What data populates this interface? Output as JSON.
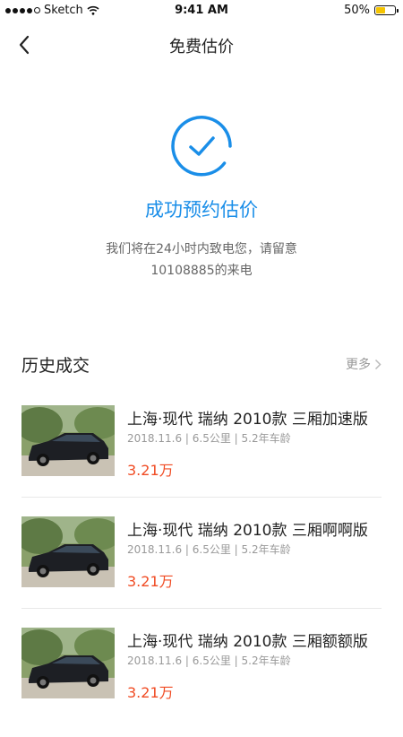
{
  "status_bar": {
    "carrier": "Sketch",
    "time": "9:41 AM",
    "battery": "50%",
    "battery_level": 0.5
  },
  "nav": {
    "title": "免费估价"
  },
  "success": {
    "title": "成功预约估价",
    "desc_line1": "我们将在24小时内致电您，请留意",
    "desc_line2": "10108885的来电",
    "accent_color": "#1a8ee8"
  },
  "history": {
    "title": "历史成交",
    "more_label": "更多",
    "items": [
      {
        "title": "上海·现代 瑞纳 2010款 三厢加速版",
        "meta": "2018.11.6 | 6.5公里 | 5.2年车龄",
        "price": "3.21万"
      },
      {
        "title": "上海·现代 瑞纳 2010款 三厢啊啊版",
        "meta": "2018.11.6 | 6.5公里 | 5.2年车龄",
        "price": "3.21万"
      },
      {
        "title": "上海·现代 瑞纳 2010款 三厢额额版",
        "meta": "2018.11.6 | 6.5公里 | 5.2年车龄",
        "price": "3.21万"
      }
    ],
    "price_color": "#f04b23"
  }
}
